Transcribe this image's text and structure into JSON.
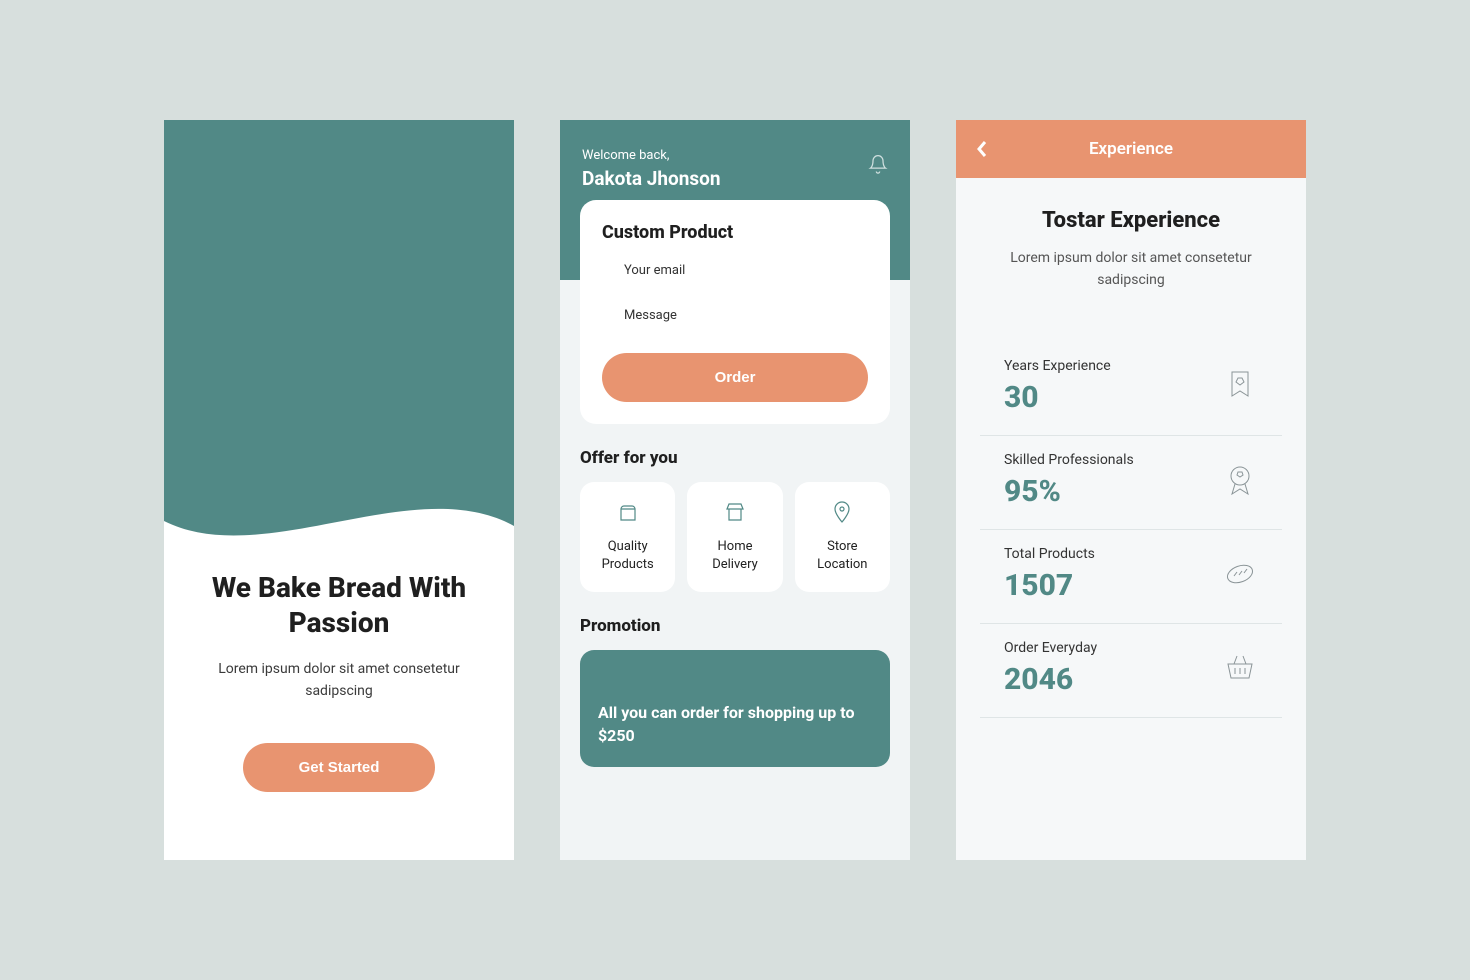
{
  "colors": {
    "teal": "#518986",
    "orange": "#e89470",
    "bg": "#d7dfdd"
  },
  "onboarding": {
    "title": "We Bake Bread With Passion",
    "subtitle": "Lorem ipsum dolor sit amet consetetur sadipscing",
    "cta": "Get Started"
  },
  "home": {
    "welcome": "Welcome back,",
    "user_name": "Dakota Jhonson",
    "card_title": "Custom Product",
    "email_label": "Your email",
    "message_label": "Message",
    "order_label": "Order",
    "offers_title": "Offer for you",
    "offers": [
      {
        "icon": "bread-icon",
        "label": "Quality Products"
      },
      {
        "icon": "store-icon",
        "label": "Home Delivery"
      },
      {
        "icon": "location-icon",
        "label": "Store Location"
      }
    ],
    "promotion_title": "Promotion",
    "promotion_text": "All you can order for shopping up to $250"
  },
  "experience": {
    "bar_title": "Experience",
    "title": "Tostar Experience",
    "subtitle": "Lorem ipsum dolor sit amet consetetur sadipscing",
    "stats": [
      {
        "label": "Years Experience",
        "value": "30",
        "icon": "ribbon-bookmark-icon"
      },
      {
        "label": "Skilled Professionals",
        "value": "95%",
        "icon": "award-badge-icon"
      },
      {
        "label": "Total Products",
        "value": "1507",
        "icon": "bread-loaf-icon"
      },
      {
        "label": "Order Everyday",
        "value": "2046",
        "icon": "basket-icon"
      }
    ]
  }
}
